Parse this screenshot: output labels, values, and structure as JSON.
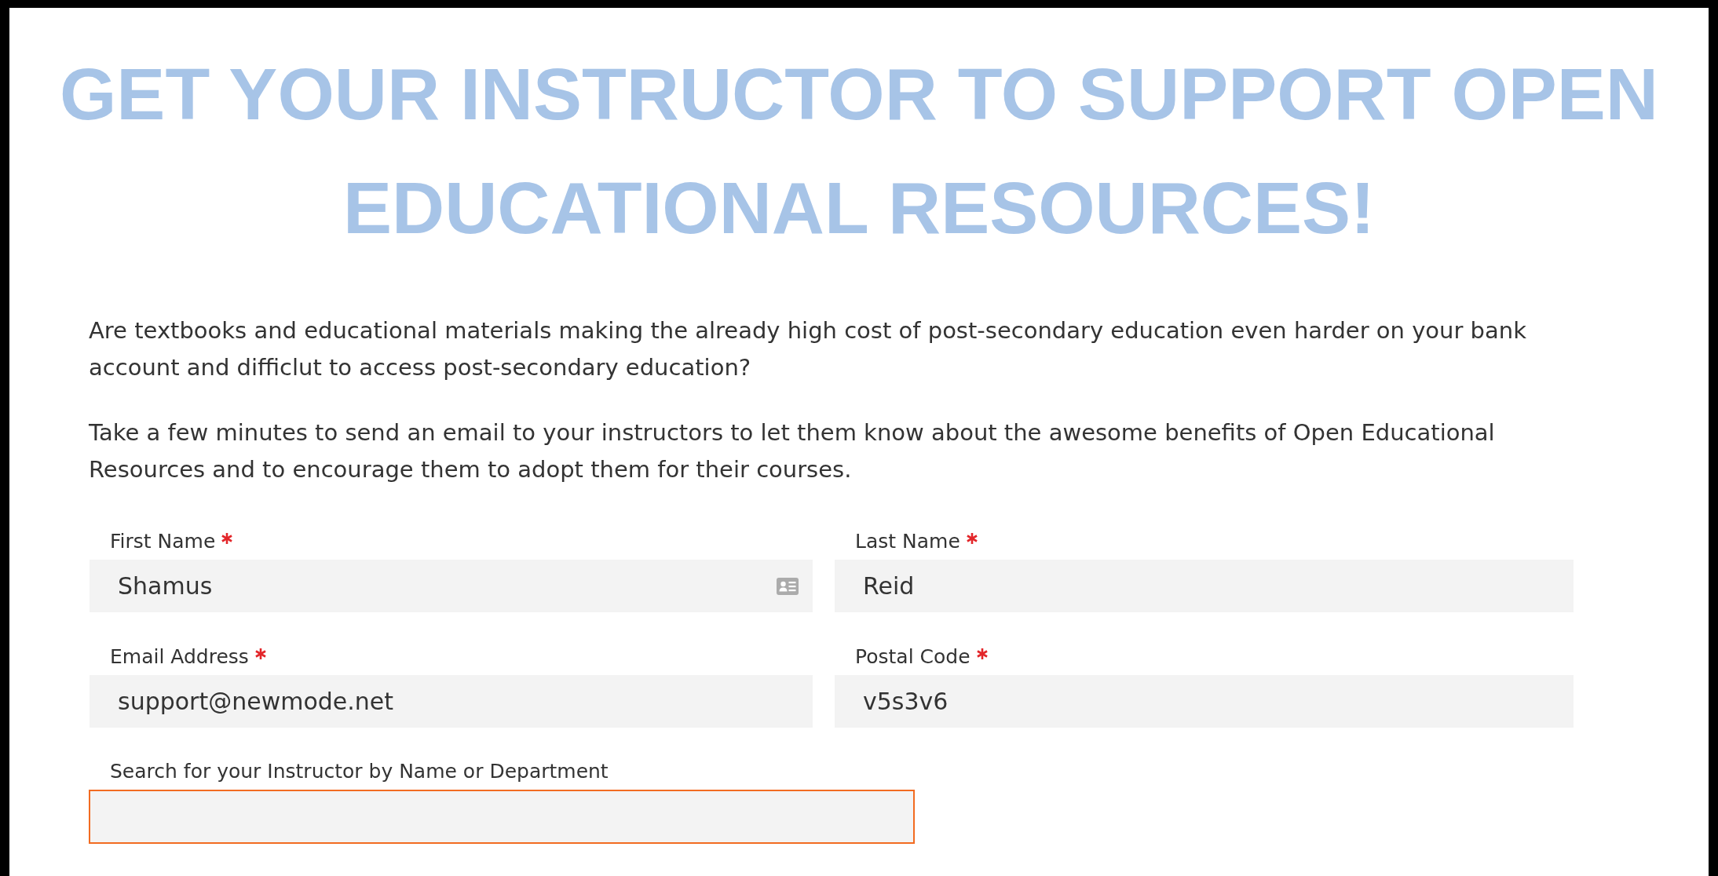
{
  "title": "GET YOUR INSTRUCTOR TO SUPPORT OPEN EDUCATIONAL RESOURCES!",
  "intro": [
    "Are textbooks and educational materials making the already high cost of post-secondary education even harder on your bank account and difficlut to access post-secondary education?",
    "Take a few minutes to send an email to your instructors to let them know about the awesome benefits of Open Educational Resources and to encourage them to adopt them for their courses."
  ],
  "fields": [
    {
      "label": "First Name",
      "required": true,
      "value": "Shamus",
      "autofill_icon": true
    },
    {
      "label": "Last Name",
      "required": true,
      "value": "Reid",
      "autofill_icon": false
    },
    {
      "label": "Email Address",
      "required": true,
      "value": "support@newmode.net",
      "autofill_icon": false
    },
    {
      "label": "Postal Code",
      "required": true,
      "value": "v5s3v6",
      "autofill_icon": false
    }
  ],
  "instructor_search": {
    "label": "Search for your Instructor by Name or Department",
    "required": false,
    "focused": true
  }
}
